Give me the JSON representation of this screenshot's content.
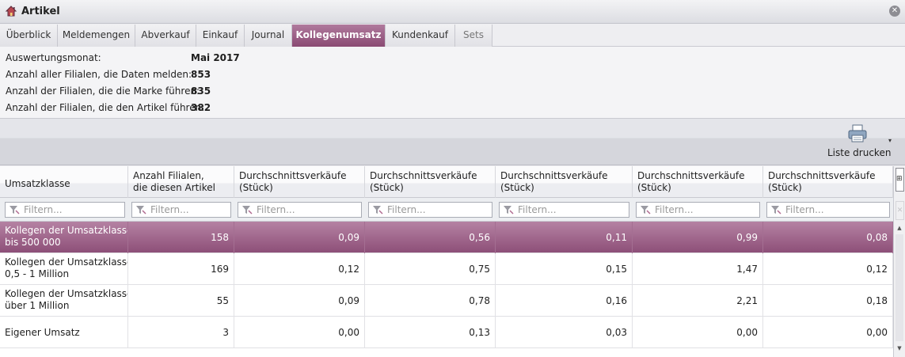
{
  "window": {
    "title": "Artikel",
    "close_glyph": "✕",
    "app_icon": "house-icon",
    "accent": "#8d4f78"
  },
  "tabs": [
    {
      "label": "Überblick",
      "active": false
    },
    {
      "label": "Meldemengen",
      "active": false
    },
    {
      "label": "Abverkauf",
      "active": false
    },
    {
      "label": "Einkauf",
      "active": false
    },
    {
      "label": "Journal",
      "active": false
    },
    {
      "label": "Kollegenumsatz",
      "active": true
    },
    {
      "label": "Kundenkauf",
      "active": false
    },
    {
      "label": "Sets",
      "active": false,
      "disabled": true
    }
  ],
  "info": [
    {
      "label": "Auswertungsmonat:",
      "value": "Mai 2017"
    },
    {
      "label": "Anzahl aller Filialen, die Daten melden:",
      "value": "853"
    },
    {
      "label": "Anzahl der Filialen, die die Marke führen:",
      "value": "835"
    },
    {
      "label": "Anzahl der Filialen, die den Artikel führen:",
      "value": "382"
    }
  ],
  "toolbar": {
    "print_label": "Liste drucken",
    "print_icon": "printer-icon",
    "dropdown_glyph": "▾"
  },
  "table": {
    "headers": [
      {
        "line1": "Umsatzklasse",
        "line2": ""
      },
      {
        "line1": "Anzahl Filialen,",
        "line2": "die diesen Artikel"
      },
      {
        "line1": "Durchschnittsverkäufe",
        "line2": "(Stück)"
      },
      {
        "line1": "Durchschnittsverkäufe",
        "line2": "(Stück)"
      },
      {
        "line1": "Durchschnittsverkäufe",
        "line2": "(Stück)"
      },
      {
        "line1": "Durchschnittsverkäufe",
        "line2": "(Stück)"
      },
      {
        "line1": "Durchschnittsverkäufe",
        "line2": "(Stück)"
      }
    ],
    "filter_placeholder": "Filtern...",
    "rows": [
      {
        "label1": "Kollegen der Umsatzklasse",
        "label2": "bis 500 000",
        "values": [
          "158",
          "0,09",
          "0,56",
          "0,11",
          "0,99",
          "0,08"
        ],
        "selected": true
      },
      {
        "label1": "Kollegen der Umsatzklasse",
        "label2": "0,5 - 1 Million",
        "values": [
          "169",
          "0,12",
          "0,75",
          "0,15",
          "1,47",
          "0,12"
        ],
        "selected": false
      },
      {
        "label1": "Kollegen der Umsatzklasse",
        "label2": "über 1 Million",
        "values": [
          "55",
          "0,09",
          "0,78",
          "0,16",
          "2,21",
          "0,18"
        ],
        "selected": false
      },
      {
        "label1": "Eigener Umsatz",
        "label2": "",
        "values": [
          "3",
          "0,00",
          "0,13",
          "0,03",
          "0,00",
          "0,00"
        ],
        "selected": false
      }
    ]
  },
  "scrollbar": {
    "up_glyph": "▲",
    "down_glyph": "▼",
    "column_chooser_icon": "column-chooser-icon",
    "column_chooser_glyph": "⊞",
    "clear_filter_icon": "clear-filter-icon",
    "clear_filter_glyph": "✕"
  }
}
